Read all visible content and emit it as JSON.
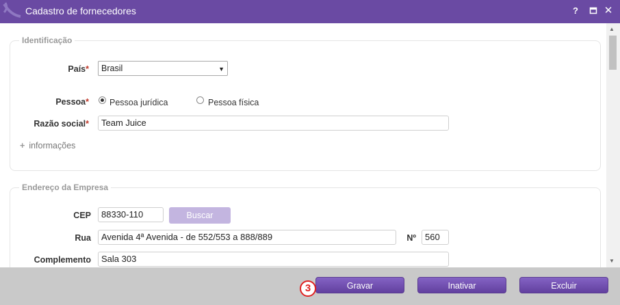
{
  "window": {
    "title": "Cadastro de fornecedores",
    "help_icon_label": "?",
    "close_icon_label": "✕"
  },
  "identificacao": {
    "legend": "Identificação",
    "pais": {
      "label": "País",
      "value": "Brasil"
    },
    "pessoa": {
      "label": "Pessoa",
      "options": [
        {
          "label": "Pessoa jurídica",
          "selected": true
        },
        {
          "label": "Pessoa física",
          "selected": false
        }
      ]
    },
    "razao_social": {
      "label": "Razão social",
      "value": "Team Juice"
    },
    "mais_informacoes": "informações",
    "required_mark": "*"
  },
  "endereco": {
    "legend": "Endereço da Empresa",
    "cep": {
      "label": "CEP",
      "value": "88330-110"
    },
    "buscar_label": "Buscar",
    "rua": {
      "label": "Rua",
      "value": "Avenida 4ª Avenida - de 552/553 a 888/889"
    },
    "numero": {
      "label": "Nº",
      "value": "560"
    },
    "complemento": {
      "label": "Complemento",
      "value": "Sala 303"
    }
  },
  "footer": {
    "gravar_label": "Gravar",
    "inativar_label": "Inativar",
    "excluir_label": "Excluir",
    "step_marker": "3"
  },
  "colors": {
    "titlebar": "#6a4aa3",
    "button": "#6d4bb0",
    "required": "#c0392b",
    "marker": "#e02020"
  }
}
